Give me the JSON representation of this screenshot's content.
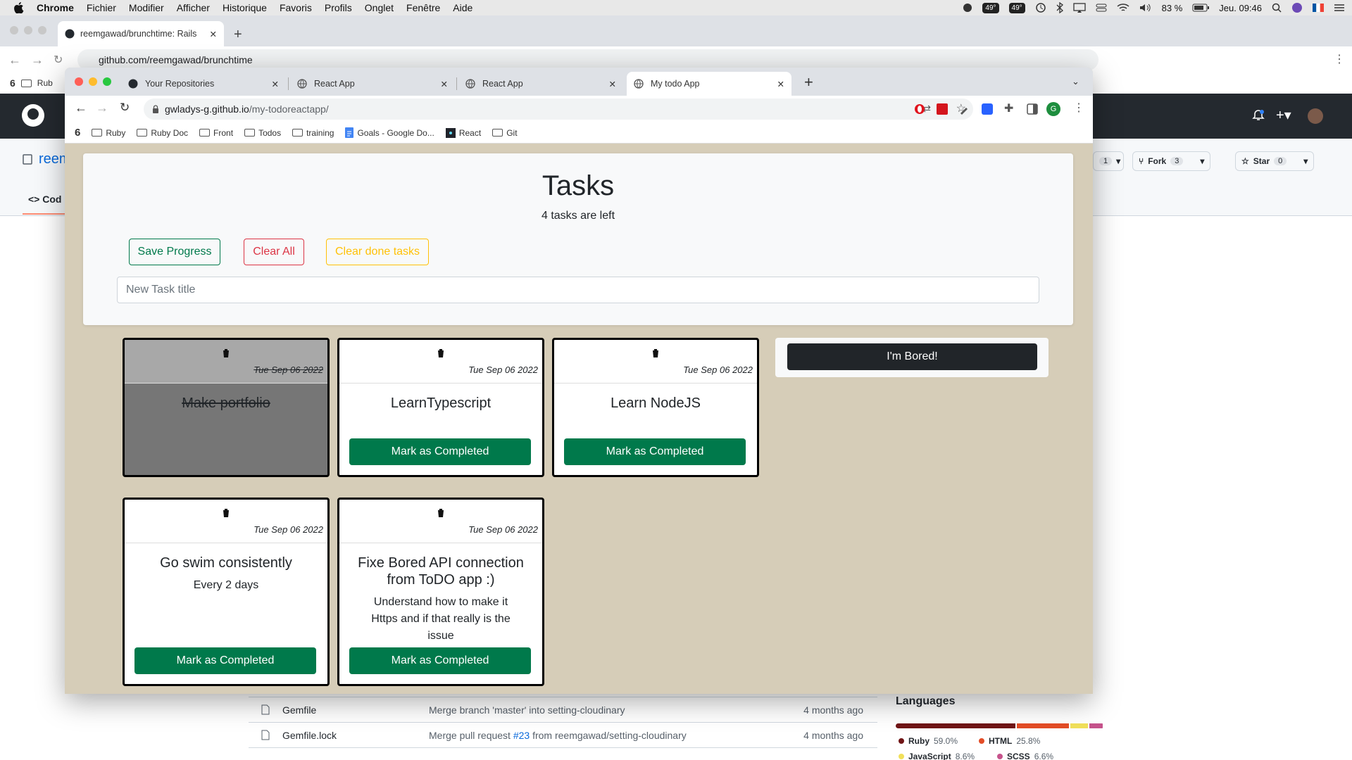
{
  "menubar": {
    "app": "Chrome",
    "items": [
      "Fichier",
      "Modifier",
      "Afficher",
      "Historique",
      "Favoris",
      "Profils",
      "Onglet",
      "Fenêtre",
      "Aide"
    ],
    "temp1": "49°",
    "temp2": "49°",
    "battery": "83 %",
    "clock": "Jeu. 09:46"
  },
  "back_window": {
    "tab_title": "reemgawad/brunchtime: Rails",
    "url": "github.com/reemgawad/brunchtime",
    "bookmark_first": "Rub",
    "repo_name_partial": "reem",
    "code_tab_partial": "Cod",
    "watch_count": "1",
    "fork_label": "Fork",
    "fork_count": "3",
    "star_label": "Star",
    "star_count": "0",
    "files": [
      {
        "name": "Gemfile",
        "message": "Merge branch 'master' into setting-cloudinary",
        "age": "4 months ago"
      },
      {
        "name": "Gemfile.lock",
        "message_pre": "Merge pull request ",
        "message_link": "#23",
        "message_post": " from reemgawad/setting-cloudinary",
        "age": "4 months ago"
      }
    ],
    "languages_title": "Languages",
    "languages": [
      {
        "name": "Ruby",
        "percent": "59.0%",
        "value": 59.0,
        "color": "#701516"
      },
      {
        "name": "HTML",
        "percent": "25.8%",
        "value": 25.8,
        "color": "#e34c26"
      },
      {
        "name": "JavaScript",
        "percent": "8.6%",
        "value": 8.6,
        "color": "#f1e05a"
      },
      {
        "name": "SCSS",
        "percent": "6.6%",
        "value": 6.6,
        "color": "#c6538c"
      }
    ]
  },
  "front_window": {
    "tabs": [
      {
        "title": "Your Repositories"
      },
      {
        "title": "React App"
      },
      {
        "title": "React App"
      },
      {
        "title": "My todo App"
      }
    ],
    "url_host": "gwladys-g.github.io",
    "url_path": "/my-todoreactapp/",
    "profile_initial": "G",
    "bookmarks": [
      "Ruby",
      "Ruby Doc",
      "Front",
      "Todos",
      "training",
      "Goals - Google Do...",
      "React",
      "Git"
    ]
  },
  "app": {
    "title": "Tasks",
    "subtitle": "4 tasks are left",
    "save_label": "Save Progress",
    "clear_all_label": "Clear All",
    "clear_done_label": "Clear done tasks",
    "new_task_placeholder": "New Task title",
    "bored_label": "I'm Bored!",
    "complete_label": "Mark as Completed",
    "tasks": [
      {
        "title": "Make portfolio",
        "description": "",
        "date": "Tue Sep 06 2022",
        "done": true
      },
      {
        "title": "LearnTypescript",
        "description": "",
        "date": "Tue Sep 06 2022",
        "done": false
      },
      {
        "title": "Learn NodeJS",
        "description": "",
        "date": "Tue Sep 06 2022",
        "done": false
      },
      {
        "title": "Go swim consistently",
        "description": "Every 2 days",
        "date": "Tue Sep 06 2022",
        "done": false
      },
      {
        "title": "Fixe Bored API connection from ToDO app :)",
        "description": "Understand how to make it Https and if that really is the issue",
        "date": "Tue Sep 06 2022",
        "done": false
      }
    ]
  },
  "colors": {
    "success": "#00794b",
    "danger": "#dc3545",
    "warning": "#ffc107",
    "dark": "#212529",
    "app_bg": "#d6cdb8"
  }
}
